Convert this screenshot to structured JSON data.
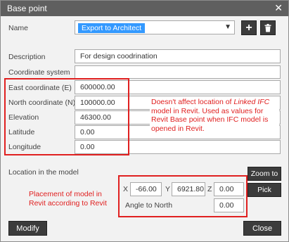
{
  "window": {
    "title": "Base point",
    "close_glyph": "✕"
  },
  "name": {
    "label": "Name",
    "selected": "Export to Architect",
    "add_glyph": "+",
    "delete_glyph": "🗑"
  },
  "fields": {
    "description": {
      "label": "Description",
      "value": "For design coodrination"
    },
    "coordinate_system": {
      "label": "Coordinate system",
      "value": ""
    },
    "east": {
      "label": "East coordinate  (E)",
      "value": "600000.00"
    },
    "north": {
      "label": "North coordinate  (N)",
      "value": "100000.00"
    },
    "elevation": {
      "label": "Elevation",
      "value": "46300.00"
    },
    "latitude": {
      "label": "Latitude",
      "value": "0.00"
    },
    "longitude": {
      "label": "Longitude",
      "value": "0.00"
    }
  },
  "location": {
    "label": "Location in the model",
    "x_label": "X",
    "x_value": "-66.00",
    "y_label": "Y",
    "y_value": "6921.80",
    "z_label": "Z",
    "z_value": "0.00",
    "angle_label": "Angle to North",
    "angle_value": "0.00",
    "zoom_button": "Zoom to",
    "pick_button": "Pick"
  },
  "annotations": {
    "ifc_note_part1": "Doesn't affect location of ",
    "ifc_note_italic": "Linked IFC",
    "ifc_note_part2": "model in Revit. Used as values for Revit Base point when IFC model is opened in Revit.",
    "placement_note": "Placement of model in Revit according to Revit"
  },
  "footer": {
    "modify_button": "Modify",
    "close_button": "Close"
  },
  "colors": {
    "titlebar": "#5f5f5f",
    "annotation_red": "#e02020",
    "selection_blue": "#3399ff",
    "button_dark": "#3c3c3c"
  }
}
